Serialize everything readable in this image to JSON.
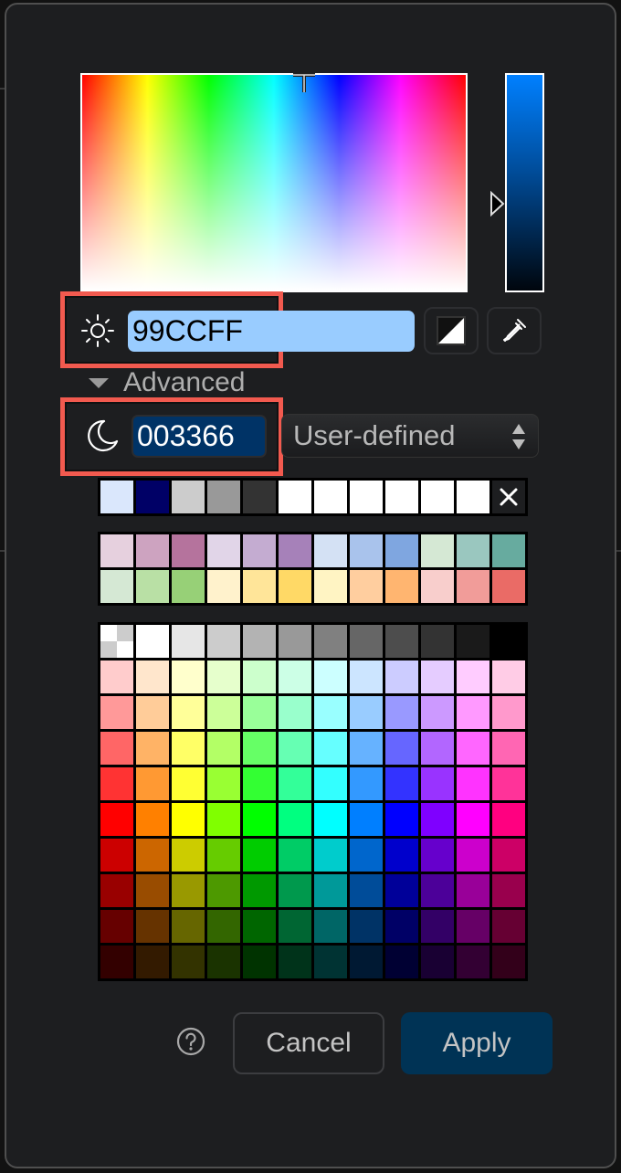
{
  "dialog": {
    "color_field": {
      "hue_cursor_label": "hue-saturation-field"
    },
    "light_color": {
      "hex_value": "99CCFF",
      "mode_icon": "sun-icon"
    },
    "dark_color": {
      "hex_value": "003366",
      "mode_icon": "moon-icon"
    },
    "toolbar": {
      "contrast_icon": "contrast-icon",
      "eyedropper_icon": "eyedropper-icon"
    },
    "advanced": {
      "label": "Advanced",
      "expanded": true
    },
    "mode_select": {
      "selected": "User-defined"
    },
    "recent_colors": [
      "#dae7fc",
      "#000066",
      "#cccccc",
      "#999999",
      "#333333",
      "#ffffff",
      "#ffffff",
      "#ffffff",
      "#ffffff",
      "#ffffff",
      "#ffffff"
    ],
    "clear_recent_icon": "close-icon",
    "theme_colors": [
      [
        "#e6d0de",
        "#cda3c0",
        "#b5739d",
        "#e1d5e8",
        "#c4acd1",
        "#a681b9",
        "#d4e1f4",
        "#a9c3ec",
        "#7fa6e0",
        "#d5e8d4",
        "#9ac7bf",
        "#67ab9f"
      ],
      [
        "#d5e8d4",
        "#b9e0a5",
        "#97d077",
        "#fff2cc",
        "#ffe599",
        "#ffd966",
        "#fff4c3",
        "#ffce9f",
        "#ffb570",
        "#f8cecc",
        "#f19c99",
        "#ea6b66"
      ]
    ],
    "palette": [
      [
        "transparent",
        "#ffffff",
        "#e6e6e6",
        "#cccccc",
        "#b3b3b3",
        "#999999",
        "#808080",
        "#666666",
        "#4d4d4d",
        "#333333",
        "#1a1a1a",
        "#000000"
      ],
      [
        "#ffcccc",
        "#ffe6cc",
        "#ffffcc",
        "#e6ffcc",
        "#ccffcc",
        "#ccffe6",
        "#ccffff",
        "#cce5ff",
        "#ccccff",
        "#e5ccff",
        "#ffccff",
        "#ffcce6"
      ],
      [
        "#ff9999",
        "#ffcc99",
        "#ffff99",
        "#ccff99",
        "#99ff99",
        "#99ffcc",
        "#99ffff",
        "#99ccff",
        "#9999ff",
        "#cc99ff",
        "#ff99ff",
        "#ff99cc"
      ],
      [
        "#ff6666",
        "#ffb366",
        "#ffff66",
        "#b3ff66",
        "#66ff66",
        "#66ffb3",
        "#66ffff",
        "#66b2ff",
        "#6666ff",
        "#b266ff",
        "#ff66ff",
        "#ff66b3"
      ],
      [
        "#ff3333",
        "#ff9933",
        "#ffff33",
        "#99ff33",
        "#33ff33",
        "#33ff99",
        "#33ffff",
        "#3399ff",
        "#3333ff",
        "#9933ff",
        "#ff33ff",
        "#ff3399"
      ],
      [
        "#ff0000",
        "#ff8000",
        "#ffff00",
        "#80ff00",
        "#00ff00",
        "#00ff80",
        "#00ffff",
        "#007fff",
        "#0000ff",
        "#7f00ff",
        "#ff00ff",
        "#ff0080"
      ],
      [
        "#cc0000",
        "#cc6600",
        "#cccc00",
        "#66cc00",
        "#00cc00",
        "#00cc66",
        "#00cccc",
        "#0066cc",
        "#0000cc",
        "#6600cc",
        "#cc00cc",
        "#cc0066"
      ],
      [
        "#990000",
        "#994c00",
        "#999900",
        "#4d9900",
        "#009900",
        "#00994d",
        "#009999",
        "#004c99",
        "#000099",
        "#4c0099",
        "#990099",
        "#99004d"
      ],
      [
        "#660000",
        "#663300",
        "#666600",
        "#336600",
        "#006600",
        "#006633",
        "#006666",
        "#003366",
        "#000066",
        "#330066",
        "#660066",
        "#660033"
      ],
      [
        "#330000",
        "#331a00",
        "#333300",
        "#1a3300",
        "#003300",
        "#00331a",
        "#003333",
        "#001933",
        "#000033",
        "#190033",
        "#330033",
        "#33001a"
      ]
    ],
    "footer": {
      "help_icon": "help-icon",
      "cancel_label": "Cancel",
      "apply_label": "Apply"
    }
  }
}
